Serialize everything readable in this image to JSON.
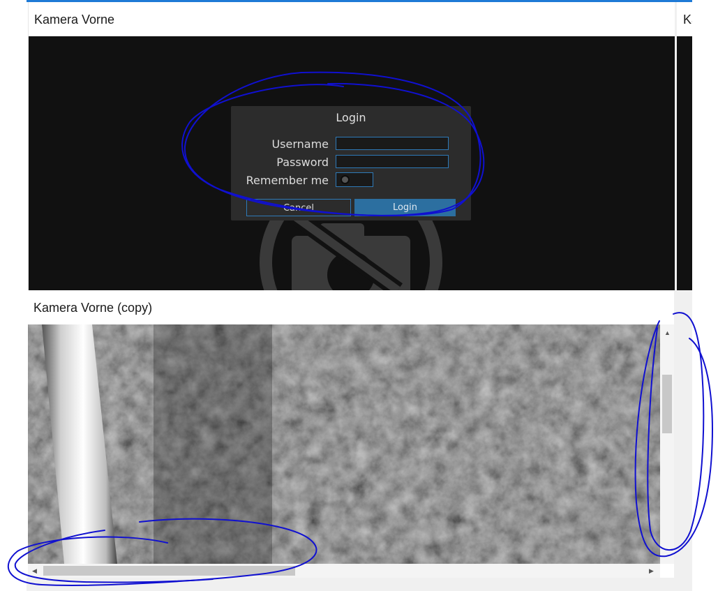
{
  "cards": [
    {
      "title": "Kamera Vorne"
    },
    {
      "title": "Kamera Vorne (copy)"
    }
  ],
  "peek_card": {
    "title": "Kamera Vorne"
  },
  "login_dialog": {
    "title": "Login",
    "username_label": "Username",
    "password_label": "Password",
    "remember_label": "Remember me",
    "username_value": "",
    "password_value": "",
    "remember_checked": false,
    "cancel_label": "Cancel",
    "login_label": "Login"
  },
  "icons": {
    "camera_off": "camera-off-icon",
    "scroll_up": "▲",
    "scroll_down": "▼",
    "scroll_left": "◀",
    "scroll_right": "▶"
  },
  "colors": {
    "accent": "#1e7ad6",
    "dialog_bg": "#2c2c2c",
    "input_border": "#2e7ab8",
    "login_button": "#2c6fa0",
    "annotation": "#1010d0"
  }
}
